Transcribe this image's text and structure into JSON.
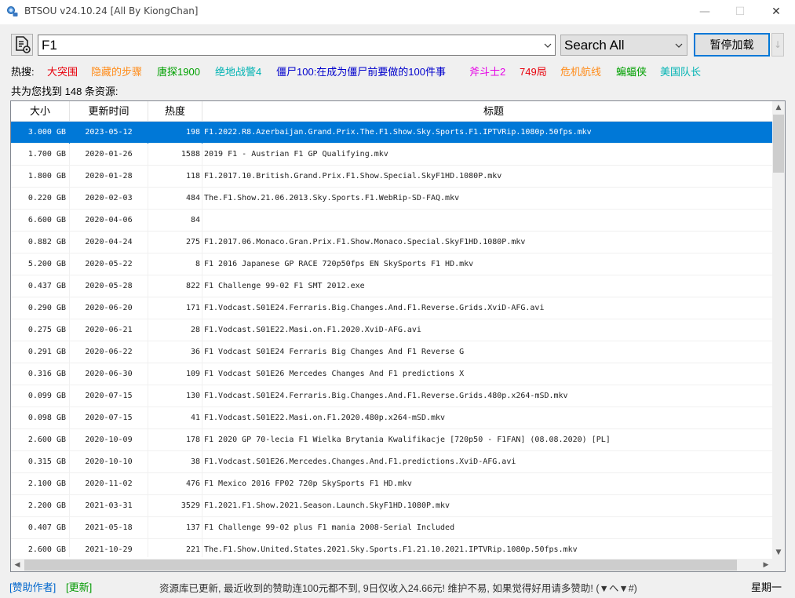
{
  "window": {
    "title": "BTSOU v24.10.24 [All By KiongChan]",
    "minimize_glyph": "—",
    "maximize_glyph": "☐",
    "close_glyph": "✕"
  },
  "search": {
    "query": "F1",
    "scope": "Search All",
    "pause_label": "暂停加载",
    "more_glyph": "↓"
  },
  "hot": {
    "label": "热搜:",
    "items": [
      {
        "text": "大突围",
        "color": "#e8000b"
      },
      {
        "text": "隐藏的步骤",
        "color": "#ff8c1a"
      },
      {
        "text": "唐探1900",
        "color": "#00a000"
      },
      {
        "text": "绝地战警4",
        "color": "#00b3b3"
      },
      {
        "text": "僵尸100:在成为僵尸前要做的100件事",
        "color": "#0000cc"
      },
      {
        "text": "斧斗士2",
        "color": "#e600e6"
      },
      {
        "text": "749局",
        "color": "#e8000b"
      },
      {
        "text": "危机航线",
        "color": "#ff8c1a"
      },
      {
        "text": "蝙蝠侠",
        "color": "#00a000"
      },
      {
        "text": "美国队长",
        "color": "#00b3b3"
      }
    ]
  },
  "result_count": "共为您找到 148 条资源:",
  "table": {
    "columns": [
      "大小",
      "更新时间",
      "热度",
      "标题"
    ],
    "selected_row": 0,
    "rows": [
      {
        "size": "3.000 GB",
        "date": "2023-05-12",
        "heat": "198",
        "title": "F1.2022.R8.Azerbaijan.Grand.Prix.The.F1.Show.Sky.Sports.F1.IPTVRip.1080p.50fps.mkv"
      },
      {
        "size": "1.700 GB",
        "date": "2020-01-26",
        "heat": "1588",
        "title": "2019 F1 - Austrian F1 GP  Qualifying.mkv"
      },
      {
        "size": "1.800 GB",
        "date": "2020-01-28",
        "heat": "118",
        "title": "F1.2017.10.British.Grand.Prix.F1.Show.Special.SkyF1HD.1080P.mkv"
      },
      {
        "size": "0.220 GB",
        "date": "2020-02-03",
        "heat": "484",
        "title": "The.F1.Show.21.06.2013.Sky.Sports.F1.WebRip-SD-FAQ.mkv"
      },
      {
        "size": "6.600 GB",
        "date": "2020-04-06",
        "heat": "84",
        "title": ""
      },
      {
        "size": "0.882 GB",
        "date": "2020-04-24",
        "heat": "275",
        "title": "F1.2017.06.Monaco.Gran.Prix.F1.Show.Monaco.Special.SkyF1HD.1080P.mkv"
      },
      {
        "size": "5.200 GB",
        "date": "2020-05-22",
        "heat": "8",
        "title": "F1 2016 Japanese GP RACE 720p50fps EN SkySports F1 HD.mkv"
      },
      {
        "size": "0.437 GB",
        "date": "2020-05-28",
        "heat": "822",
        "title": "F1 Challenge 99-02 F1 SMT 2012.exe"
      },
      {
        "size": "0.290 GB",
        "date": "2020-06-20",
        "heat": "171",
        "title": "F1.Vodcast.S01E24.Ferraris.Big.Changes.And.F1.Reverse.Grids.XviD-AFG.avi"
      },
      {
        "size": "0.275 GB",
        "date": "2020-06-21",
        "heat": "28",
        "title": "F1.Vodcast.S01E22.Masi.on.F1.2020.XviD-AFG.avi"
      },
      {
        "size": "0.291 GB",
        "date": "2020-06-22",
        "heat": "36",
        "title": "F1 Vodcast S01E24 Ferraris Big Changes And F1 Reverse G"
      },
      {
        "size": "0.316 GB",
        "date": "2020-06-30",
        "heat": "109",
        "title": "F1 Vodcast S01E26 Mercedes Changes And F1 predictions X"
      },
      {
        "size": "0.099 GB",
        "date": "2020-07-15",
        "heat": "130",
        "title": "F1.Vodcast.S01E24.Ferraris.Big.Changes.And.F1.Reverse.Grids.480p.x264-mSD.mkv"
      },
      {
        "size": "0.098 GB",
        "date": "2020-07-15",
        "heat": "41",
        "title": "F1.Vodcast.S01E22.Masi.on.F1.2020.480p.x264-mSD.mkv"
      },
      {
        "size": "2.600 GB",
        "date": "2020-10-09",
        "heat": "178",
        "title": "F1 2020 GP 70-lecia F1 Wielka Brytania Kwalifikacje [720p50 - F1FAN] (08.08.2020) [PL]"
      },
      {
        "size": "0.315 GB",
        "date": "2020-10-10",
        "heat": "38",
        "title": "F1.Vodcast.S01E26.Mercedes.Changes.And.F1.predictions.XviD-AFG.avi"
      },
      {
        "size": "2.100 GB",
        "date": "2020-11-02",
        "heat": "476",
        "title": "F1 Mexico 2016 FP02 720p SkySports F1 HD.mkv"
      },
      {
        "size": "2.200 GB",
        "date": "2021-03-31",
        "heat": "3529",
        "title": "F1.2021.F1.Show.2021.Season.Launch.SkyF1HD.1080P.mkv"
      },
      {
        "size": "0.407 GB",
        "date": "2021-05-18",
        "heat": "137",
        "title": "F1 Challenge 99-02 plus F1 mania 2008-Serial Included"
      },
      {
        "size": "2.600 GB",
        "date": "2021-10-29",
        "heat": "221",
        "title": "The.F1.Show.United.States.2021.Sky.Sports.F1.21.10.2021.IPTVRip.1080p.50fps.mkv"
      }
    ]
  },
  "status": {
    "sponsor": "[赞助作者]",
    "update": "[更新]",
    "message": "资源库已更新, 最近收到的赞助连100元都不到, 9日仅收入24.66元! 维护不易, 如果觉得好用请多赞助! (▼ヘ▼#)",
    "weekday": "星期一"
  },
  "icons": {
    "app": "magnifier-person-icon",
    "search_doc": "document-gear-icon",
    "dropdown": "chevron-down-icon"
  }
}
